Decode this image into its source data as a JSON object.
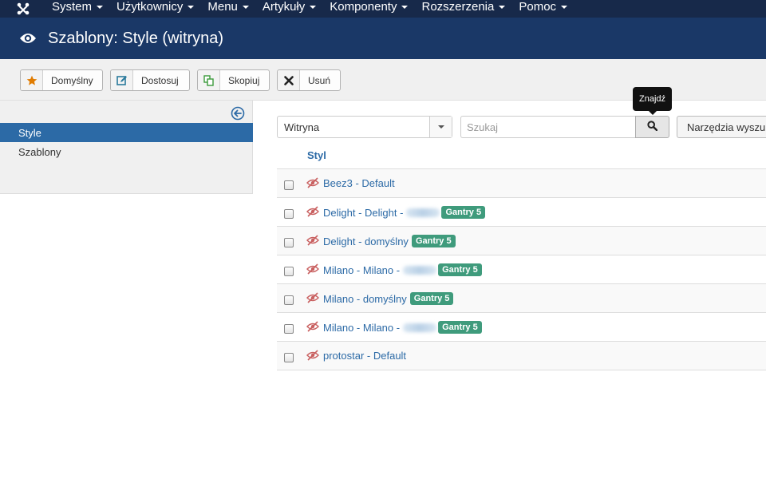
{
  "navbar": {
    "items": [
      {
        "label": "System"
      },
      {
        "label": "Użytkownicy"
      },
      {
        "label": "Menu"
      },
      {
        "label": "Artykuły"
      },
      {
        "label": "Komponenty"
      },
      {
        "label": "Rozszerzenia"
      },
      {
        "label": "Pomoc"
      }
    ]
  },
  "header": {
    "title": "Szablony: Style (witryna)",
    "icon": "eye-icon"
  },
  "toolbar": {
    "default_label": "Domyślny",
    "edit_label": "Dostosuj",
    "copy_label": "Skopiuj",
    "delete_label": "Usuń"
  },
  "sidebar": {
    "items": [
      {
        "label": "Style",
        "active": true
      },
      {
        "label": "Szablony",
        "active": false
      }
    ]
  },
  "filters": {
    "client_select": "Witryna",
    "search_placeholder": "Szukaj",
    "search_tooltip": "Znajdź",
    "tools_label": "Narzędzia wyszukiwania"
  },
  "table": {
    "column_header": "Styl",
    "rows": [
      {
        "name": "Beez3 - Default",
        "badge": ""
      },
      {
        "name": "Delight - Delight -",
        "badge": "Gantry 5"
      },
      {
        "name": "Delight - domyślny",
        "badge": "Gantry 5"
      },
      {
        "name": "Milano - Milano -",
        "badge": "Gantry 5"
      },
      {
        "name": "Milano - domyślny",
        "badge": "Gantry 5"
      },
      {
        "name": "Milano - Milano -",
        "badge": "Gantry 5"
      },
      {
        "name": "protostar - Default",
        "badge": ""
      }
    ]
  },
  "colors": {
    "navbar": "#17294a",
    "header": "#1a3867",
    "link": "#2c6aa6",
    "badge": "#3f9b7c",
    "star": "#e07b00"
  }
}
